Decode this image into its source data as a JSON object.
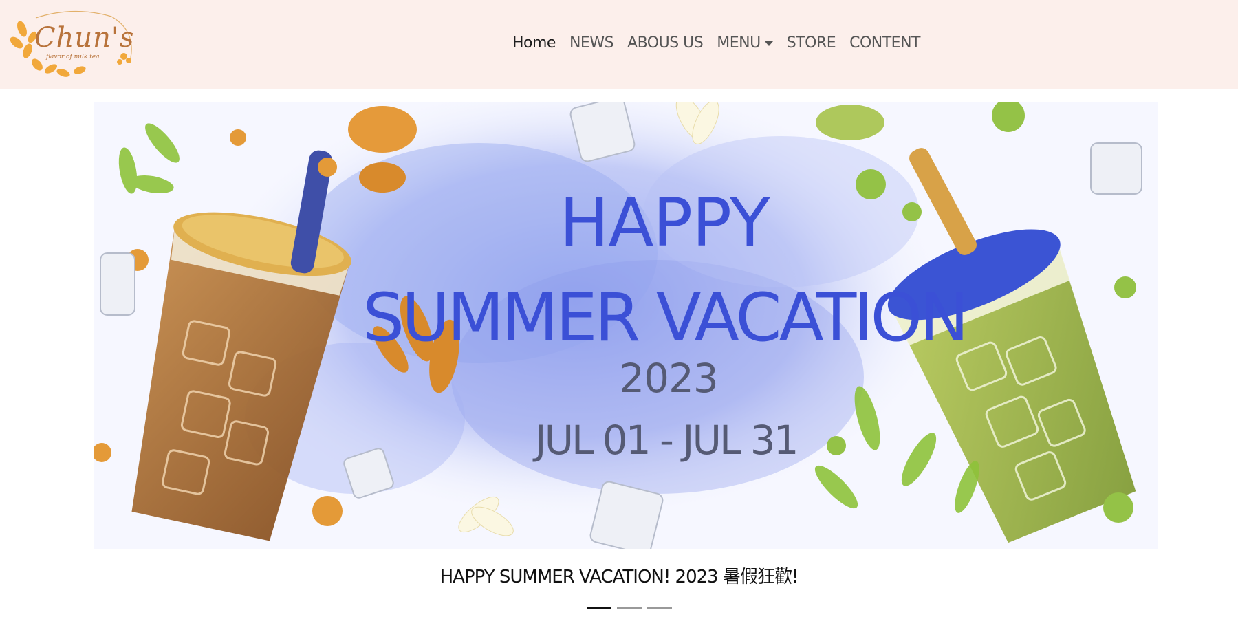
{
  "header": {
    "brand": {
      "name": "Chun's",
      "tagline": "flavor of milk tea"
    },
    "nav": [
      {
        "label": "Home",
        "active": true
      },
      {
        "label": "NEWS"
      },
      {
        "label": "ABOUS US"
      },
      {
        "label": "MENU",
        "dropdown": true
      },
      {
        "label": "STORE"
      },
      {
        "label": "CONTENT"
      }
    ],
    "background": "#fcefeb"
  },
  "carousel": {
    "slide": {
      "line1": "HAPPY",
      "line2": "SUMMER VACATION",
      "year": "2023",
      "dates": "JUL 01 - JUL 31"
    },
    "caption": "HAPPY SUMMER VACATION! 2023 暑假狂歡!",
    "indicators": {
      "count": 3,
      "active": 0
    },
    "colors": {
      "headline": "#3b50d6",
      "subtext": "#555a74",
      "splash": "#8fa0ef"
    }
  }
}
